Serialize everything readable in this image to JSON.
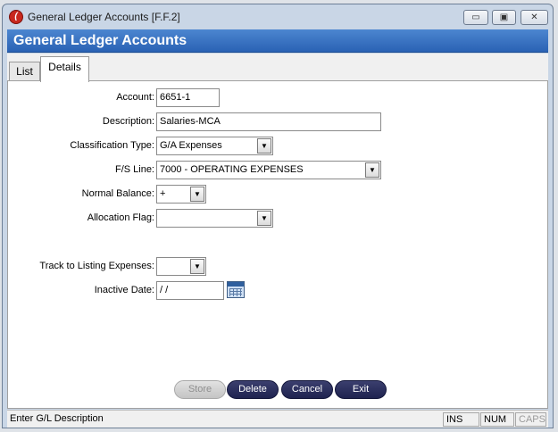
{
  "window": {
    "title": "General Ledger Accounts [F.F.2]",
    "app_icon_glyph": "(",
    "min_glyph": "▭",
    "max_glyph": "▣",
    "close_glyph": "✕"
  },
  "header": {
    "title": "General Ledger Accounts"
  },
  "tabs": [
    {
      "label": "List"
    },
    {
      "label": "Details"
    }
  ],
  "form": {
    "account": {
      "label": "Account:",
      "value": "6651-1"
    },
    "description": {
      "label": "Description:",
      "value": "Salaries-MCA"
    },
    "classification_type": {
      "label": "Classification Type:",
      "value": "G/A Expenses"
    },
    "fs_line": {
      "label": "F/S Line:",
      "value": "7000 - OPERATING EXPENSES"
    },
    "normal_balance": {
      "label": "Normal Balance:",
      "value": "+"
    },
    "allocation_flag": {
      "label": "Allocation Flag:",
      "value": ""
    },
    "track_listing": {
      "label": "Track to Listing Expenses:",
      "value": ""
    },
    "inactive_date": {
      "label": "Inactive Date:",
      "value": " /  /"
    }
  },
  "dropdown_arrow": "▼",
  "buttons": {
    "store": "Store",
    "delete": "Delete",
    "cancel": "Cancel",
    "exit": "Exit"
  },
  "status": {
    "message": "Enter G/L Description",
    "ins": "INS",
    "num": "NUM",
    "caps": "CAPS"
  }
}
